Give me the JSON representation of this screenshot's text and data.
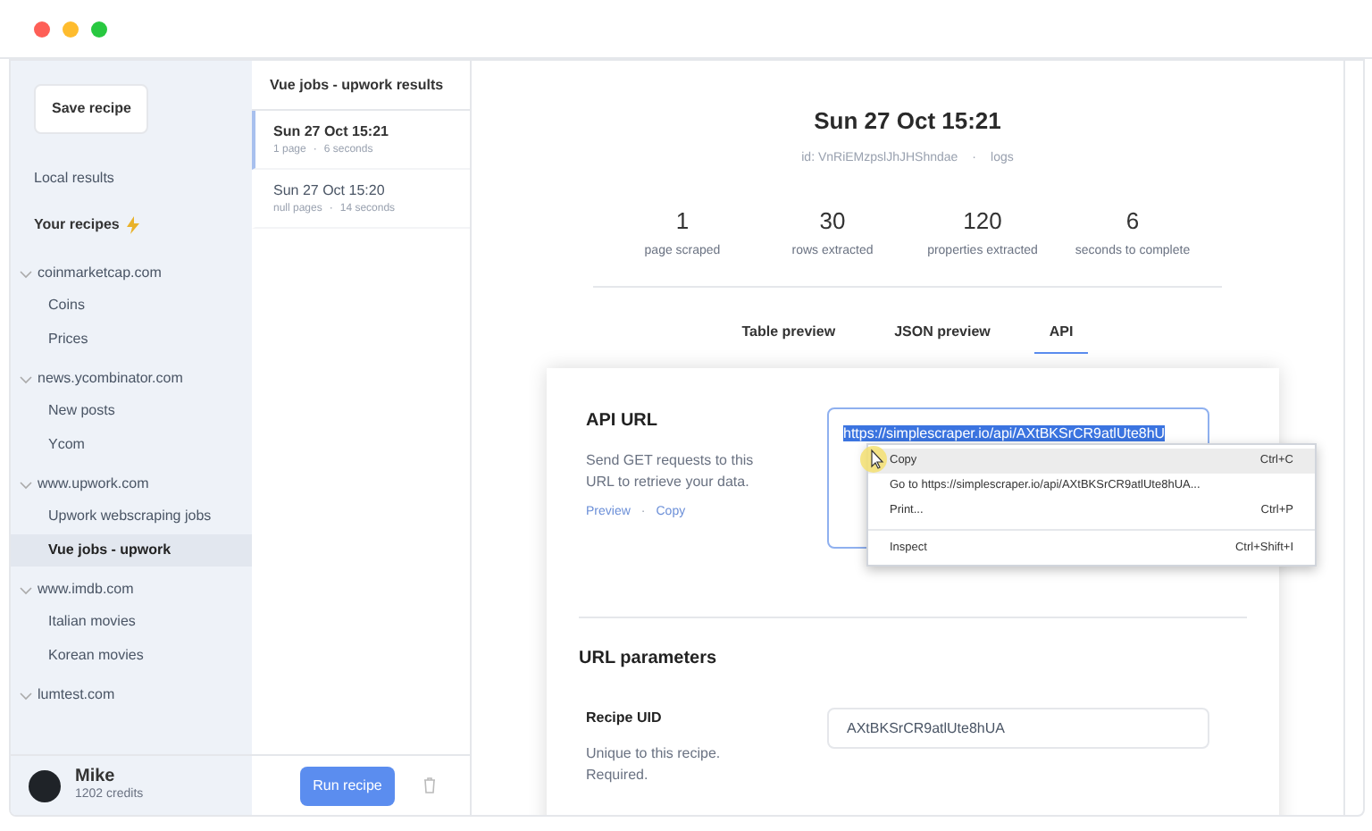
{
  "sidebar": {
    "save_button": "Save recipe",
    "local_results": "Local results",
    "your_recipes": "Your recipes",
    "groups": [
      {
        "label": "coinmarketcap.com",
        "expanded": true,
        "children": [
          {
            "label": "Coins",
            "selected": false
          },
          {
            "label": "Prices",
            "selected": false
          }
        ]
      },
      {
        "label": "news.ycombinator.com",
        "expanded": true,
        "children": [
          {
            "label": "New posts",
            "selected": false
          },
          {
            "label": "Ycom",
            "selected": false
          }
        ]
      },
      {
        "label": "www.upwork.com",
        "expanded": true,
        "children": [
          {
            "label": "Upwork webscraping jobs",
            "selected": false
          },
          {
            "label": "Vue jobs - upwork",
            "selected": true
          }
        ]
      },
      {
        "label": "www.imdb.com",
        "expanded": true,
        "children": [
          {
            "label": "Italian movies",
            "selected": false
          },
          {
            "label": "Korean movies",
            "selected": false
          }
        ]
      },
      {
        "label": "lumtest.com",
        "expanded": true
      }
    ],
    "user": {
      "name": "Mike",
      "credits": "1202 credits"
    }
  },
  "runs": {
    "title": "Vue jobs - upwork results",
    "items": [
      {
        "date": "Sun 27 Oct 15:21",
        "pages": "1 page",
        "separator": "·",
        "duration": "6 seconds",
        "selected": true
      },
      {
        "date": "Sun 27 Oct 15:20",
        "pages": "null pages",
        "separator": "·",
        "duration": "14 seconds",
        "selected": false
      }
    ],
    "run_button": "Run recipe"
  },
  "detail": {
    "title": "Sun 27 Oct 15:21",
    "id": "id: VnRiEMzpslJhJHShndae",
    "id_separator": "·",
    "logs": "logs",
    "stats": [
      {
        "value": "1",
        "label": "page scraped"
      },
      {
        "value": "30",
        "label": "rows extracted"
      },
      {
        "value": "120",
        "label": "properties extracted"
      },
      {
        "value": "6",
        "label": "seconds to complete"
      }
    ],
    "tabs": [
      {
        "label": "Table preview",
        "selected": false
      },
      {
        "label": "JSON preview",
        "selected": false
      },
      {
        "label": "API",
        "selected": true
      }
    ],
    "api": {
      "heading": "API URL",
      "description": "Send GET requests to this URL to retrieve your data.",
      "preview_link": "Preview",
      "link_separator": "·",
      "copy_link": "Copy",
      "url": "https://simplescraper.io/api/AXtBKSrCR9atlUte8hU"
    },
    "params": {
      "heading": "URL parameters",
      "fields": [
        {
          "label": "Recipe UID",
          "description": "Unique to this recipe. Required.",
          "value": "AXtBKSrCR9atlUte8hUA"
        }
      ]
    }
  },
  "context_menu": [
    {
      "label": "Copy",
      "shortcut": "Ctrl+C",
      "selected": true,
      "divider_before": false
    },
    {
      "label": "Go to https://simplescraper.io/api/AXtBKSrCR9atlUte8hUA...",
      "selected": false,
      "divider_before": false
    },
    {
      "label": "Print...",
      "shortcut": "Ctrl+P",
      "selected": false,
      "divider_before": false
    },
    {
      "label": "Inspect",
      "shortcut": "Ctrl+Shift+I",
      "selected": false,
      "divider_before": true
    }
  ]
}
